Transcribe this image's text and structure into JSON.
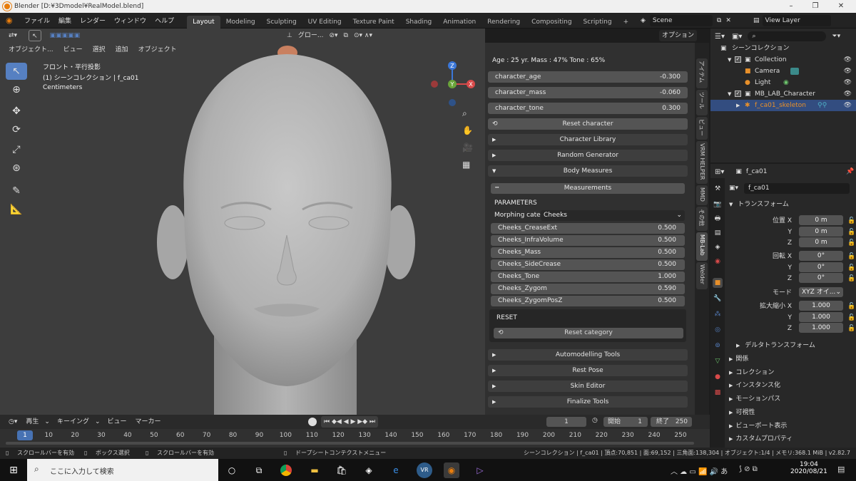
{
  "window": {
    "title": "Blender [D:¥3Dmodel¥RealModel.blend]"
  },
  "menubar": {
    "menus": [
      "ファイル",
      "編集",
      "レンダー",
      "ウィンドウ",
      "ヘルプ"
    ],
    "workspaces": [
      "Layout",
      "Modeling",
      "Sculpting",
      "UV Editing",
      "Texture Paint",
      "Shading",
      "Animation",
      "Rendering",
      "Compositing",
      "Scripting"
    ],
    "active_workspace": "Layout",
    "add_tab": "+",
    "scene": "Scene",
    "view_layer": "View Layer"
  },
  "viewport_header": {
    "mode": "オブジェクト...",
    "menus": [
      "ビュー",
      "選択",
      "追加",
      "オブジェクト"
    ],
    "transform_orientation": "グロー...",
    "options": "オプション"
  },
  "viewport": {
    "view_name": "フロント・平行投影",
    "collection_info": "(1) シーンコレクション | f_ca01",
    "units": "Centimeters",
    "gizmo": {
      "z": "Z",
      "y": "Y",
      "x": "X"
    }
  },
  "npanel": {
    "info": "Age : 25 yr.  Mass : 47%  Tone : 65%",
    "sliders": [
      {
        "label": "character_age",
        "value": "-0.300"
      },
      {
        "label": "character_mass",
        "value": "-0.060"
      },
      {
        "label": "character_tone",
        "value": "0.300"
      }
    ],
    "reset_character": "Reset character",
    "panels_top": [
      "Character Library",
      "Random Generator"
    ],
    "body_measures": "Body Measures",
    "measurements": "Measurements",
    "parameters_title": "PARAMETERS",
    "morph_category_label": "Morphing cate..",
    "morph_category_value": "Cheeks",
    "params": [
      {
        "label": "Cheeks_CreaseExt",
        "value": "0.500"
      },
      {
        "label": "Cheeks_InfraVolume",
        "value": "0.500"
      },
      {
        "label": "Cheeks_Mass",
        "value": "0.500"
      },
      {
        "label": "Cheeks_SideCrease",
        "value": "0.500"
      },
      {
        "label": "Cheeks_Tone",
        "value": "1.000"
      },
      {
        "label": "Cheeks_Zygom",
        "value": "0.590"
      },
      {
        "label": "Cheeks_ZygomPosZ",
        "value": "0.500"
      }
    ],
    "reset_title": "RESET",
    "reset_category": "Reset category",
    "panels_bottom": [
      "Automodelling Tools",
      "Rest Pose",
      "Skin Editor",
      "Finalize Tools"
    ]
  },
  "vtabs": [
    "アイテム",
    "ツール",
    "ビュー",
    "VRM HELPER",
    "MMD",
    "その他",
    "MB-Lab",
    "Welder"
  ],
  "outliner": {
    "root": "シーンコレクション",
    "items": [
      {
        "name": "Collection",
        "level": 1
      },
      {
        "name": "Camera",
        "level": 2
      },
      {
        "name": "Light",
        "level": 2
      },
      {
        "name": "MB_LAB_Character",
        "level": 1
      },
      {
        "name": "f_ca01_skeleton",
        "level": 2
      }
    ]
  },
  "properties": {
    "object_name": "f_ca01",
    "object_field": "f_ca01",
    "transform": "トランスフォーム",
    "location_label": "位置",
    "rotation_label": "回転",
    "scale_label": "拡大縮小",
    "axes": [
      "X",
      "Y",
      "Z"
    ],
    "location": [
      "0 m",
      "0 m",
      "0 m"
    ],
    "rotation": [
      "0°",
      "0°",
      "0°"
    ],
    "scale": [
      "1.000",
      "1.000",
      "1.000"
    ],
    "mode_label": "モード",
    "mode_value": "XYZ オイ...",
    "delta": "デルタトランスフォーム",
    "sections": [
      "関係",
      "コレクション",
      "インスタンス化",
      "モーションパス",
      "可視性",
      "ビューポート表示",
      "カスタムプロパティ"
    ]
  },
  "timeline": {
    "menus": [
      "再生",
      "キーイング",
      "ビュー",
      "マーカー"
    ],
    "current_frame": "1",
    "start_label": "開始",
    "start": "1",
    "end_label": "終了",
    "end": "250",
    "ticks": [
      "1",
      "10",
      "20",
      "30",
      "40",
      "50",
      "60",
      "70",
      "80",
      "90",
      "100",
      "110",
      "120",
      "130",
      "140",
      "150",
      "160",
      "170",
      "180",
      "190",
      "200",
      "210",
      "220",
      "230",
      "240",
      "250"
    ]
  },
  "statusbar": {
    "hints": [
      "スクロールバーを有効",
      "ボックス選択",
      "スクロールバーを有効",
      "ドープシートコンテクストメニュー"
    ],
    "stats": "シーンコレクション | f_ca01 | 頂点:70,851 | 面:69,152 | 三角面:138,304 | オブジェクト:1/4 | メモリ:368.1 MiB | v2.82.7"
  },
  "taskbar": {
    "search_placeholder": "ここに入力して検索",
    "time": "19:04",
    "date": "2020/08/21"
  },
  "colors": {
    "accent": "#5680c2",
    "blender_orange": "#e87d0d",
    "skeleton": "#e8902a"
  }
}
